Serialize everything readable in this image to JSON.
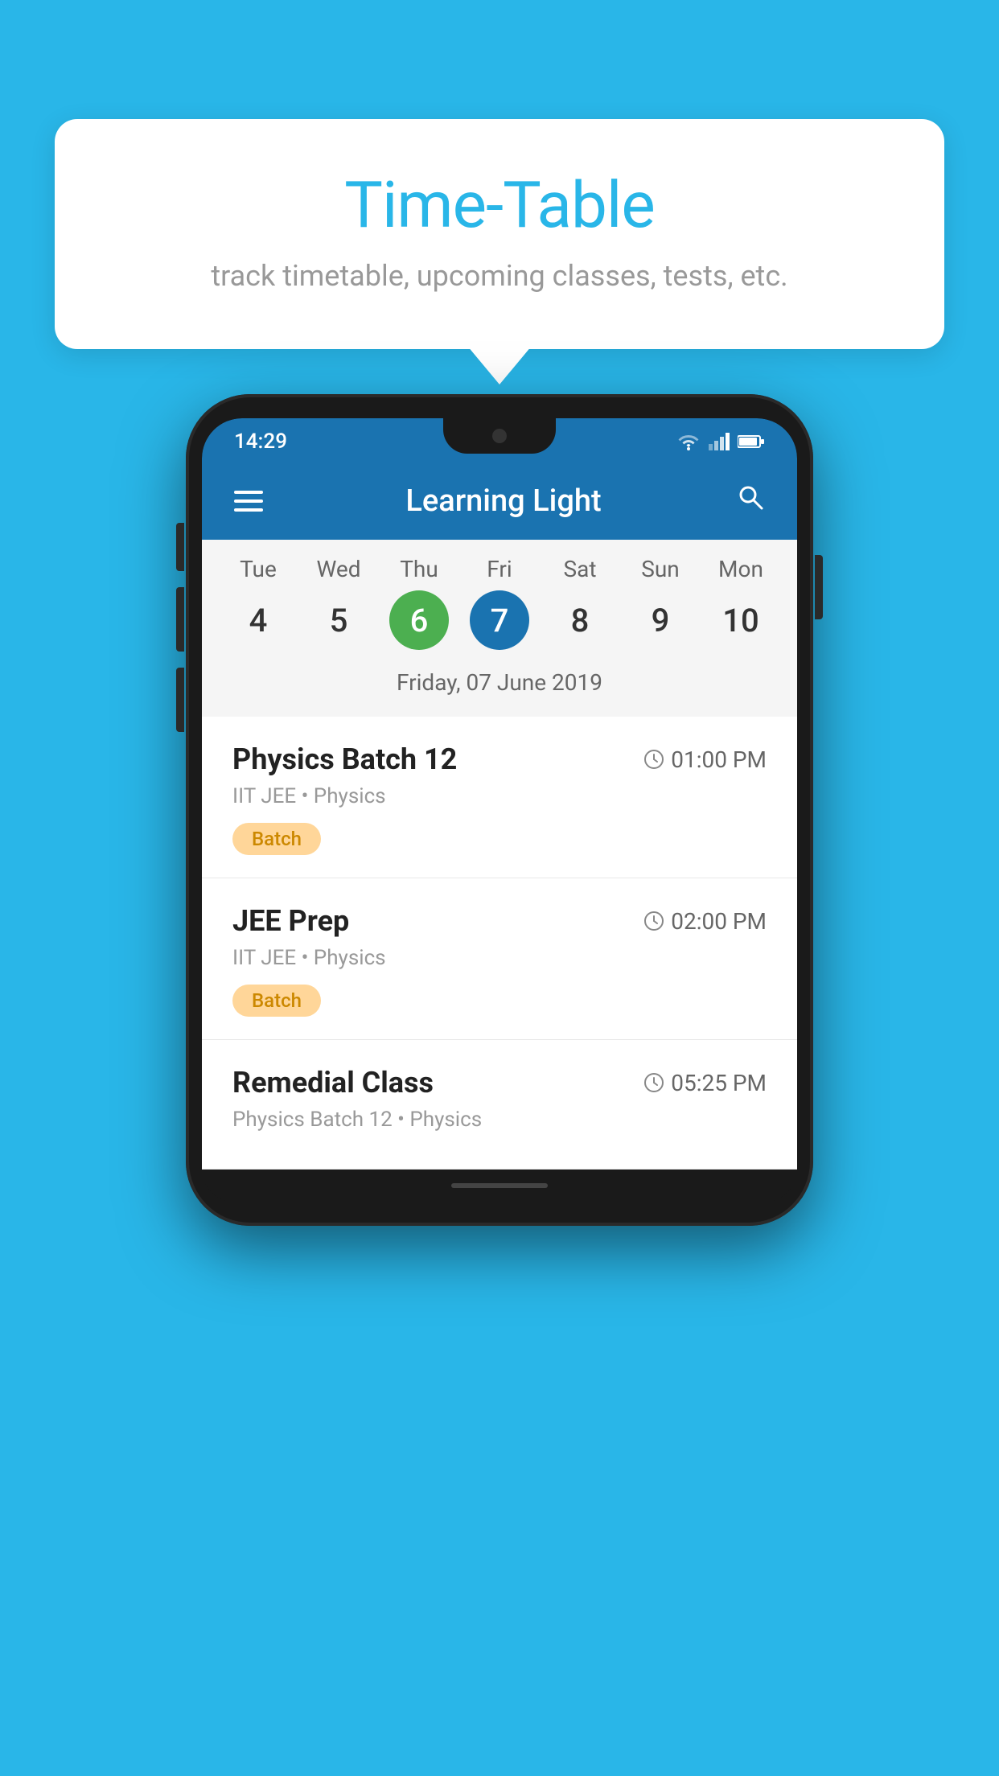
{
  "background_color": "#29b6e8",
  "tooltip": {
    "title": "Time-Table",
    "subtitle": "track timetable, upcoming classes, tests, etc."
  },
  "app": {
    "title": "Learning Light",
    "status_time": "14:29"
  },
  "calendar": {
    "days": [
      {
        "label": "Tue",
        "number": "4"
      },
      {
        "label": "Wed",
        "number": "5"
      },
      {
        "label": "Thu",
        "number": "6",
        "state": "today"
      },
      {
        "label": "Fri",
        "number": "7",
        "state": "selected"
      },
      {
        "label": "Sat",
        "number": "8"
      },
      {
        "label": "Sun",
        "number": "9"
      },
      {
        "label": "Mon",
        "number": "10"
      }
    ],
    "selected_date_label": "Friday, 07 June 2019"
  },
  "classes": [
    {
      "name": "Physics Batch 12",
      "time": "01:00 PM",
      "meta": "IIT JEE • Physics",
      "badge": "Batch"
    },
    {
      "name": "JEE Prep",
      "time": "02:00 PM",
      "meta": "IIT JEE • Physics",
      "badge": "Batch"
    },
    {
      "name": "Remedial Class",
      "time": "05:25 PM",
      "meta": "Physics Batch 12 • Physics",
      "badge": null
    }
  ],
  "icons": {
    "hamburger": "≡",
    "search": "🔍",
    "clock": "🕐"
  }
}
